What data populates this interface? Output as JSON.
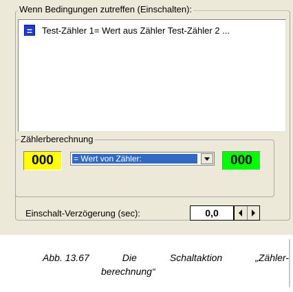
{
  "conditions_group": {
    "legend": "Wenn Bedingungen zutreffen (Einschalten):",
    "items": [
      {
        "icon": "equals-icon",
        "icon_text": "=",
        "text": "Test-Zähler 1= Wert aus Zähler Test-Zähler 2 ..."
      }
    ]
  },
  "calc_group": {
    "legend": "Zählerberechnung",
    "left_counter": "000",
    "operation": "= Wert von Zähler:",
    "right_counter": "000",
    "colors": {
      "left_counter_bg": "#ffff00",
      "right_counter_bg": "#00ff00",
      "selection_bg": "#316ac5"
    }
  },
  "delay": {
    "label": "Einschalt-Verzögerung (sec):",
    "value": "0,0"
  },
  "caption": {
    "part1": "Abb. 13.67",
    "part2": "Die",
    "part3": "Schaltaktion",
    "part4": "„Zähler-",
    "part5": "berechnung“"
  }
}
